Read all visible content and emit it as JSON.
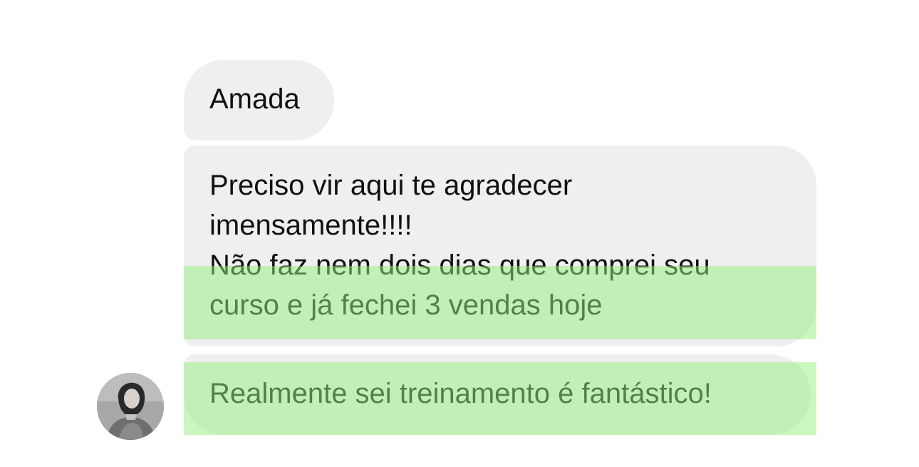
{
  "conversation": {
    "messages": [
      {
        "lines": [
          "Amada"
        ]
      },
      {
        "lines": [
          "Preciso vir aqui te agradecer",
          "imensamente!!!!",
          "Não faz nem dois dias que comprei seu",
          "curso e já fechei 3 vendas hoje"
        ]
      },
      {
        "lines": [
          "Realmente sei treinamento é fantástico!"
        ]
      }
    ],
    "avatar": {
      "icon": "person-photo-icon"
    },
    "colors": {
      "bubble_background": "#efefef",
      "highlight": "#96f082",
      "text": "#111111"
    }
  }
}
